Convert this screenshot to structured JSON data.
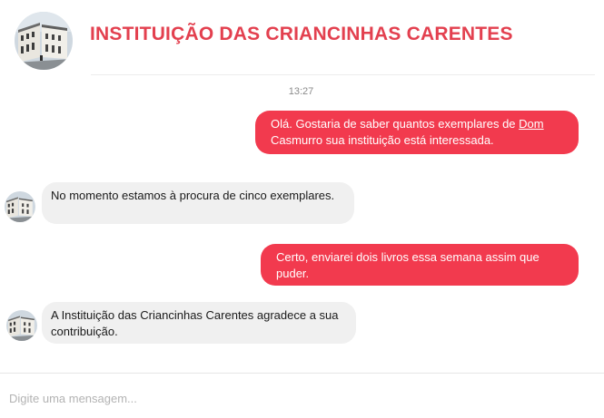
{
  "header": {
    "title": "INSTITUIÇÃO DAS CRIANCINHAS CARENTES",
    "avatar_icon": "building-street-photo-icon"
  },
  "conversation": {
    "timestamp": "13:27",
    "messages": [
      {
        "direction": "outgoing",
        "text_before": "Olá. Gostaria de saber quantos exemplares de ",
        "link_text": "Dom",
        "text_after": " Casmurro sua instituição está interessada."
      },
      {
        "direction": "incoming",
        "text": "No momento estamos à procura de cinco exemplares."
      },
      {
        "direction": "outgoing",
        "text": "Certo, enviarei dois livros essa semana assim que puder."
      },
      {
        "direction": "incoming",
        "text": "A Instituição das Criancinhas Carentes  agradece a sua contribuição."
      }
    ]
  },
  "composer": {
    "placeholder": "Digite uma mensagem..."
  },
  "colors": {
    "accent": "#e3404f",
    "outgoing_bubble": "#f23a4e",
    "incoming_bubble": "#f0f0f0"
  }
}
